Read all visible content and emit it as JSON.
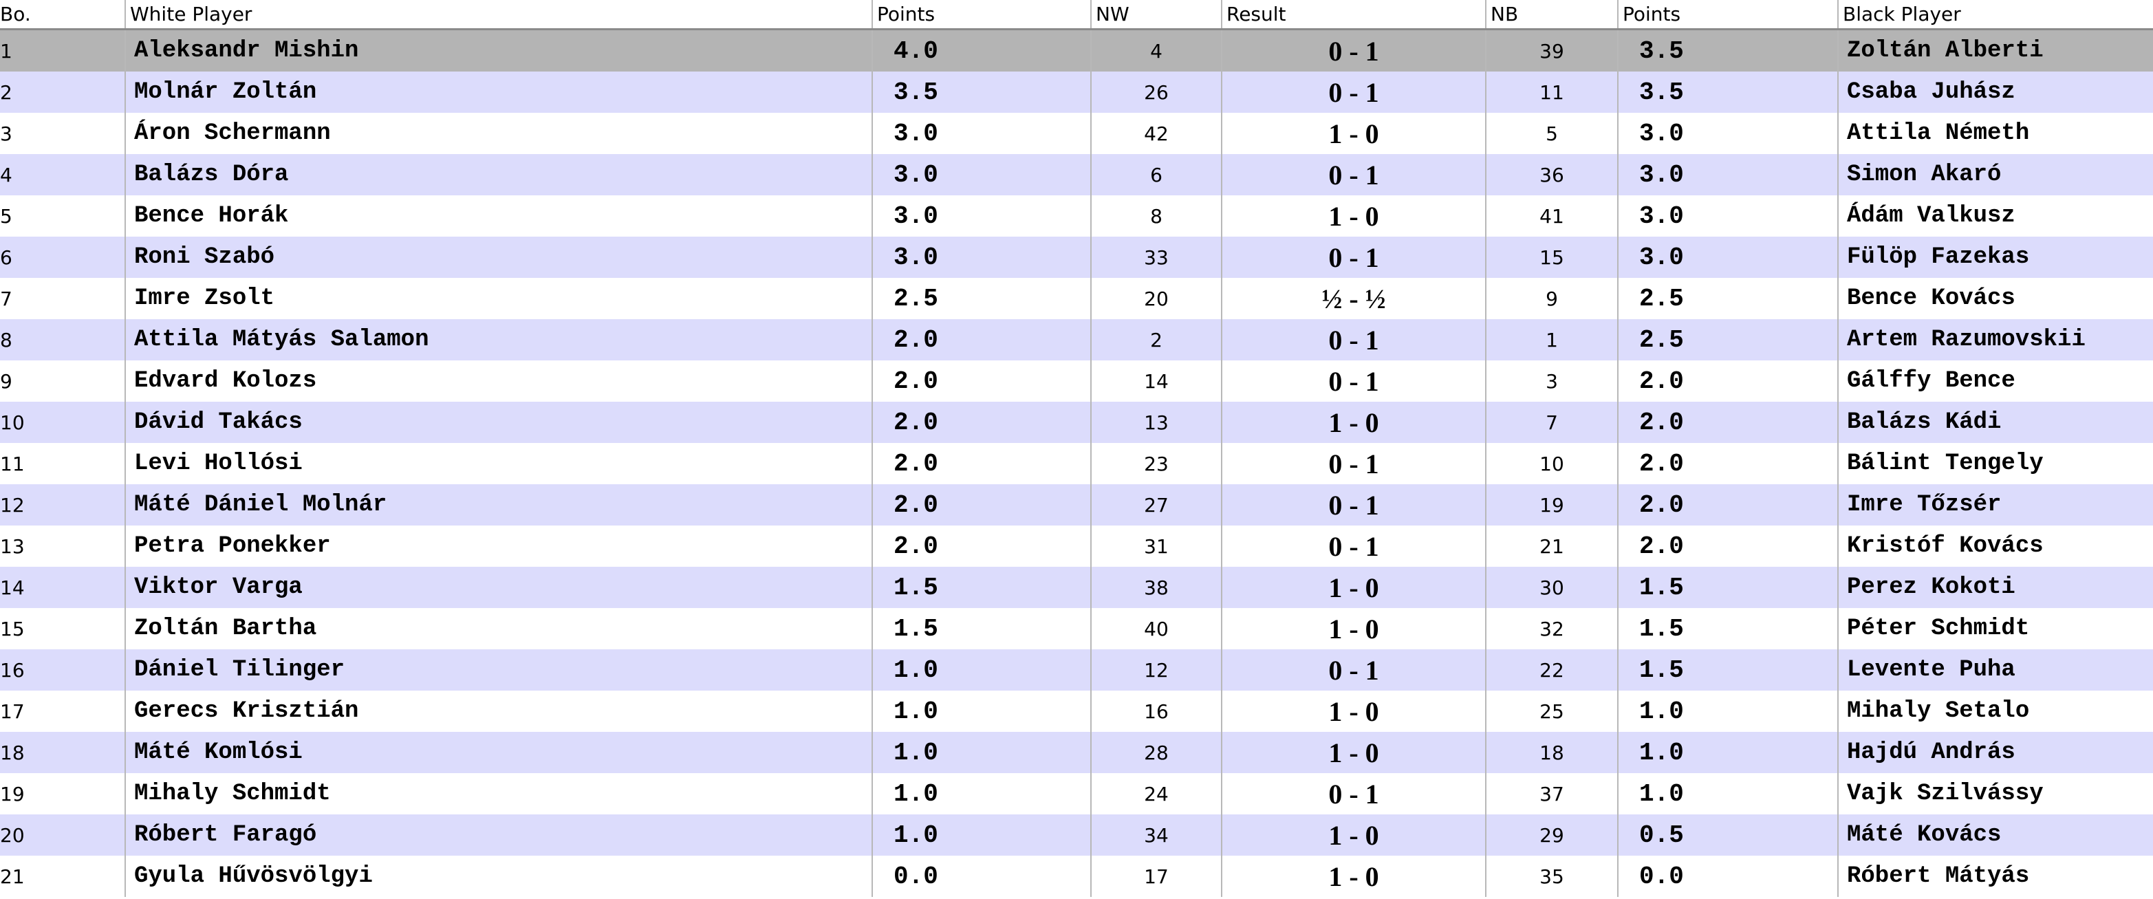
{
  "columns": {
    "board": "Bo.",
    "white_player": "White Player",
    "white_points": "Points",
    "white_number": "NW",
    "result": "Result",
    "black_number": "NB",
    "black_points": "Points",
    "black_player": "Black Player"
  },
  "selected_row": 1,
  "colors": {
    "row_alt": "#dcdcfc",
    "row_selected": "#b4b4b4",
    "grid": "#b8b8b8"
  },
  "pairings": [
    {
      "board": "1",
      "white": "Aleksandr Mishin",
      "white_points": "4.0",
      "nw": "4",
      "result": "0 - 1",
      "nb": "39",
      "black_points": "3.5",
      "black": "Zoltán Alberti"
    },
    {
      "board": "2",
      "white": "Molnár Zoltán",
      "white_points": "3.5",
      "nw": "26",
      "result": "0 - 1",
      "nb": "11",
      "black_points": "3.5",
      "black": "Csaba Juhász"
    },
    {
      "board": "3",
      "white": "Áron Schermann",
      "white_points": "3.0",
      "nw": "42",
      "result": "1 - 0",
      "nb": "5",
      "black_points": "3.0",
      "black": "Attila Németh"
    },
    {
      "board": "4",
      "white": "Balázs Dóra",
      "white_points": "3.0",
      "nw": "6",
      "result": "0 - 1",
      "nb": "36",
      "black_points": "3.0",
      "black": "Simon Akaró"
    },
    {
      "board": "5",
      "white": "Bence Horák",
      "white_points": "3.0",
      "nw": "8",
      "result": "1 - 0",
      "nb": "41",
      "black_points": "3.0",
      "black": "Ádám Valkusz"
    },
    {
      "board": "6",
      "white": "Roni Szabó",
      "white_points": "3.0",
      "nw": "33",
      "result": "0 - 1",
      "nb": "15",
      "black_points": "3.0",
      "black": "Fülöp Fazekas"
    },
    {
      "board": "7",
      "white": "Imre Zsolt",
      "white_points": "2.5",
      "nw": "20",
      "result": "½ - ½",
      "nb": "9",
      "black_points": "2.5",
      "black": "Bence Kovács"
    },
    {
      "board": "8",
      "white": "Attila Mátyás Salamon",
      "white_points": "2.0",
      "nw": "2",
      "result": "0 - 1",
      "nb": "1",
      "black_points": "2.5",
      "black": "Artem Razumovskii"
    },
    {
      "board": "9",
      "white": "Edvard Kolozs",
      "white_points": "2.0",
      "nw": "14",
      "result": "0 - 1",
      "nb": "3",
      "black_points": "2.0",
      "black": "Gálffy Bence"
    },
    {
      "board": "10",
      "white": "Dávid Takács",
      "white_points": "2.0",
      "nw": "13",
      "result": "1 - 0",
      "nb": "7",
      "black_points": "2.0",
      "black": "Balázs Kádi"
    },
    {
      "board": "11",
      "white": "Levi Hollósi",
      "white_points": "2.0",
      "nw": "23",
      "result": "0 - 1",
      "nb": "10",
      "black_points": "2.0",
      "black": "Bálint Tengely"
    },
    {
      "board": "12",
      "white": "Máté Dániel Molnár",
      "white_points": "2.0",
      "nw": "27",
      "result": "0 - 1",
      "nb": "19",
      "black_points": "2.0",
      "black": "Imre Tőzsér"
    },
    {
      "board": "13",
      "white": "Petra Ponekker",
      "white_points": "2.0",
      "nw": "31",
      "result": "0 - 1",
      "nb": "21",
      "black_points": "2.0",
      "black": "Kristóf Kovács"
    },
    {
      "board": "14",
      "white": "Viktor Varga",
      "white_points": "1.5",
      "nw": "38",
      "result": "1 - 0",
      "nb": "30",
      "black_points": "1.5",
      "black": "Perez Kokoti"
    },
    {
      "board": "15",
      "white": "Zoltán Bartha",
      "white_points": "1.5",
      "nw": "40",
      "result": "1 - 0",
      "nb": "32",
      "black_points": "1.5",
      "black": "Péter Schmidt"
    },
    {
      "board": "16",
      "white": "Dániel Tilinger",
      "white_points": "1.0",
      "nw": "12",
      "result": "0 - 1",
      "nb": "22",
      "black_points": "1.5",
      "black": "Levente Puha"
    },
    {
      "board": "17",
      "white": "Gerecs Krisztián",
      "white_points": "1.0",
      "nw": "16",
      "result": "1 - 0",
      "nb": "25",
      "black_points": "1.0",
      "black": "Mihaly Setalo"
    },
    {
      "board": "18",
      "white": "Máté Komlósi",
      "white_points": "1.0",
      "nw": "28",
      "result": "1 - 0",
      "nb": "18",
      "black_points": "1.0",
      "black": "Hajdú András"
    },
    {
      "board": "19",
      "white": "Mihaly Schmidt",
      "white_points": "1.0",
      "nw": "24",
      "result": "0 - 1",
      "nb": "37",
      "black_points": "1.0",
      "black": "Vajk Szilvássy"
    },
    {
      "board": "20",
      "white": "Róbert Faragó",
      "white_points": "1.0",
      "nw": "34",
      "result": "1 - 0",
      "nb": "29",
      "black_points": "0.5",
      "black": "Máté Kovács"
    },
    {
      "board": "21",
      "white": "Gyula Hűvösvölgyi",
      "white_points": "0.0",
      "nw": "17",
      "result": "1 - 0",
      "nb": "35",
      "black_points": "0.0",
      "black": "Róbert Mátyás"
    }
  ]
}
